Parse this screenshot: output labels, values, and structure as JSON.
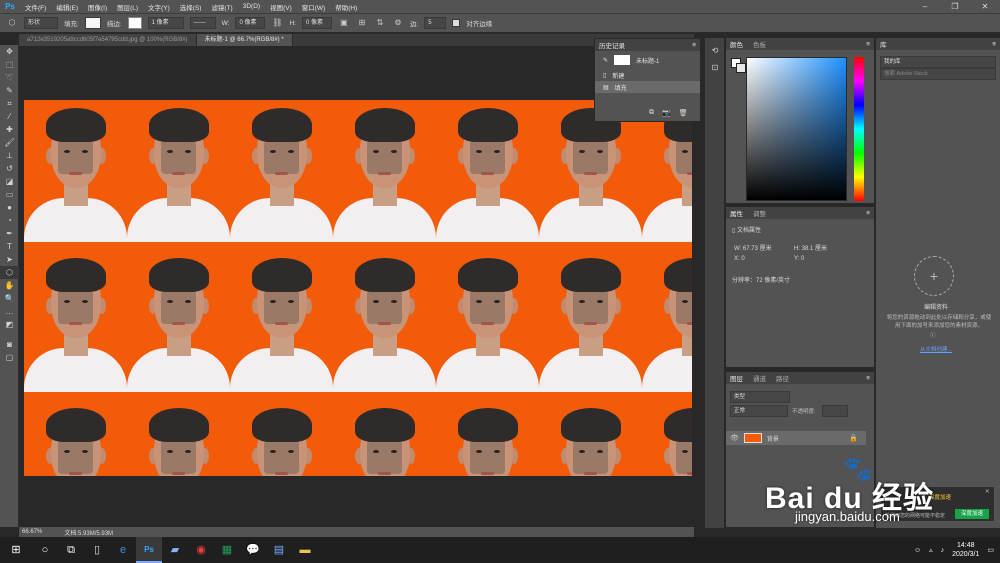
{
  "app": {
    "logo": "Ps"
  },
  "menu": [
    "文件(F)",
    "编辑(E)",
    "图像(I)",
    "图层(L)",
    "文字(Y)",
    "选择(S)",
    "滤镜(T)",
    "3D(D)",
    "视图(V)",
    "窗口(W)",
    "帮助(H)"
  ],
  "options": {
    "shape_mode": "形状",
    "fill_label": "填充:",
    "stroke_label": "描边:",
    "stroke_width": "1 像素",
    "w_label": "W:",
    "w_value": "0 像素",
    "h_label": "H:",
    "h_value": "0 像素",
    "sides_label": "边:",
    "sides_value": "5",
    "align_edges": "对齐边缘"
  },
  "tabs": [
    {
      "label": "a712e3519205a9ccd605f7e54795cdd.jpg @ 100%(RGB/8#)",
      "active": false
    },
    {
      "label": "未标题-1 @ 66.7%(RGB/8#) *",
      "active": true
    }
  ],
  "history": {
    "title": "历史记录",
    "snapshot": "未标题-1",
    "items": [
      "新建",
      "填充"
    ]
  },
  "color": {
    "tab1": "颜色",
    "tab2": "色板"
  },
  "properties": {
    "tab1": "属性",
    "tab2": "调整",
    "section": "文档属性",
    "w_label": "W:",
    "w_value": "67.73 厘米",
    "h_label": "H:",
    "h_value": "38.1 厘米",
    "x_label": "X:",
    "x_value": "0",
    "y_label": "Y:",
    "y_value": "0",
    "resolution": "分辨率：72 像素/英寸"
  },
  "layers": {
    "tab1": "图层",
    "tab2": "通道",
    "tab3": "路径",
    "kind": "类型",
    "blend": "正常",
    "opacity_label": "不透明度:",
    "layer_name": "背景"
  },
  "library": {
    "title": "库",
    "dropdown": "我的库",
    "search_placeholder": "搜索 Adobe Stock",
    "empty_title": "编辑资料",
    "empty_desc": "将您的资源拖动到此处以存储和分享，或使用下面的加号来添加您的素材资源。",
    "link": "从文档创建..."
  },
  "status": {
    "zoom": "66.67%",
    "doc": "文档:5.93M/5.93M"
  },
  "taskbar": {
    "time": "14:48",
    "date": "2020/3/1"
  },
  "notify": {
    "title": "深度加速",
    "button": "深度加速",
    "text": "检测到您的网络可能不稳定"
  },
  "watermark": {
    "brand": "Bai du 经验",
    "url": "jingyan.baidu.com"
  },
  "photo_rows": 3,
  "photos_per_row": 7
}
